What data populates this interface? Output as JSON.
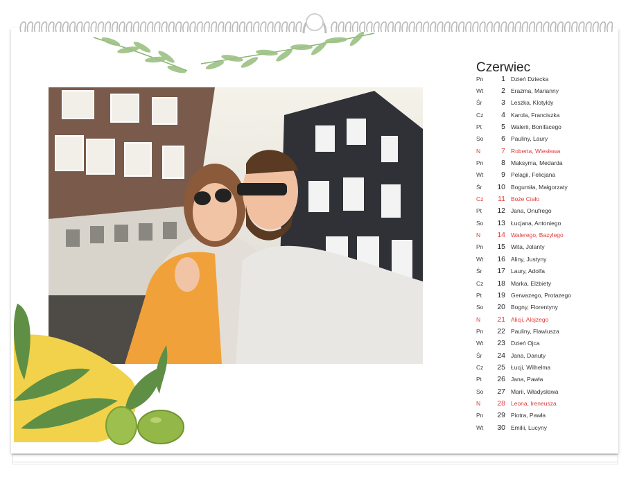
{
  "calendar": {
    "month": "Czerwiec",
    "days": [
      {
        "dow": "Pn",
        "num": "1",
        "names": "Dzień Dziecka",
        "holiday": false
      },
      {
        "dow": "Wt",
        "num": "2",
        "names": "Erazma, Marianny",
        "holiday": false
      },
      {
        "dow": "Śr",
        "num": "3",
        "names": "Leszka, Klotyldy",
        "holiday": false
      },
      {
        "dow": "Cz",
        "num": "4",
        "names": "Karola, Franciszka",
        "holiday": false
      },
      {
        "dow": "Pt",
        "num": "5",
        "names": "Walerii, Bonifacego",
        "holiday": false
      },
      {
        "dow": "So",
        "num": "6",
        "names": "Pauliny, Laury",
        "holiday": false
      },
      {
        "dow": "N",
        "num": "7",
        "names": "Roberta, Wiesława",
        "holiday": true
      },
      {
        "dow": "Pn",
        "num": "8",
        "names": "Maksyma, Medarda",
        "holiday": false
      },
      {
        "dow": "Wt",
        "num": "9",
        "names": "Pelagii, Felicjana",
        "holiday": false
      },
      {
        "dow": "Śr",
        "num": "10",
        "names": "Bogumiła, Małgorzaty",
        "holiday": false
      },
      {
        "dow": "Cz",
        "num": "11",
        "names": "Boże Ciało",
        "holiday": true
      },
      {
        "dow": "Pt",
        "num": "12",
        "names": "Jana, Onufrego",
        "holiday": false
      },
      {
        "dow": "So",
        "num": "13",
        "names": "Łucjana, Antoniego",
        "holiday": false
      },
      {
        "dow": "N",
        "num": "14",
        "names": "Walerego, Bazylego",
        "holiday": true
      },
      {
        "dow": "Pn",
        "num": "15",
        "names": "Wita, Jolanty",
        "holiday": false
      },
      {
        "dow": "Wt",
        "num": "16",
        "names": "Aliny, Justyny",
        "holiday": false
      },
      {
        "dow": "Śr",
        "num": "17",
        "names": "Laury, Adolfa",
        "holiday": false
      },
      {
        "dow": "Cz",
        "num": "18",
        "names": "Marka, Elżbiety",
        "holiday": false
      },
      {
        "dow": "Pt",
        "num": "19",
        "names": "Gerwazego, Protazego",
        "holiday": false
      },
      {
        "dow": "So",
        "num": "20",
        "names": "Bogny, Florentyny",
        "holiday": false
      },
      {
        "dow": "N",
        "num": "21",
        "names": "Alicji, Alojzego",
        "holiday": true
      },
      {
        "dow": "Pn",
        "num": "22",
        "names": "Pauliny, Flawiusza",
        "holiday": false
      },
      {
        "dow": "Wt",
        "num": "23",
        "names": "Dzień Ojca",
        "holiday": false
      },
      {
        "dow": "Śr",
        "num": "24",
        "names": "Jana, Danuty",
        "holiday": false
      },
      {
        "dow": "Cz",
        "num": "25",
        "names": "Łucji, Wilhelma",
        "holiday": false
      },
      {
        "dow": "Pt",
        "num": "26",
        "names": "Jana, Pawła",
        "holiday": false
      },
      {
        "dow": "So",
        "num": "27",
        "names": "Marii, Władysława",
        "holiday": false
      },
      {
        "dow": "N",
        "num": "28",
        "names": "Leona, Ireneusza",
        "holiday": true
      },
      {
        "dow": "Pn",
        "num": "29",
        "names": "Piotra, Pawła",
        "holiday": false
      },
      {
        "dow": "Wt",
        "num": "30",
        "names": "Emilii, Lucyny",
        "holiday": false
      }
    ]
  },
  "colors": {
    "holiday": "#e23b3b",
    "text": "#333333",
    "leaf": "#7fae5f",
    "olive": "#9cbf4e",
    "lemon": "#f2d24a"
  }
}
